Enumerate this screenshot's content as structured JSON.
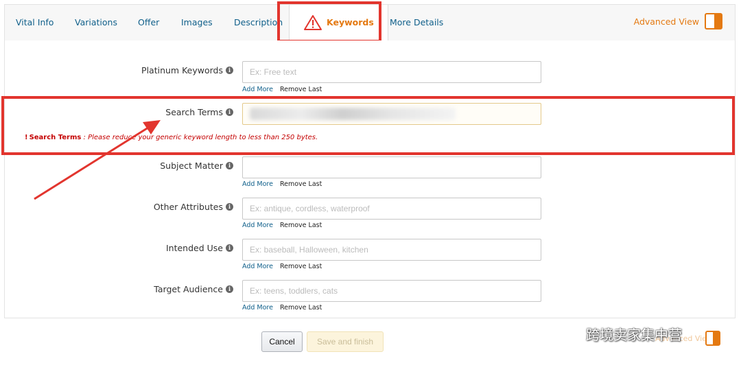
{
  "tabs": [
    {
      "label": "Vital Info"
    },
    {
      "label": "Variations"
    },
    {
      "label": "Offer"
    },
    {
      "label": "Images"
    },
    {
      "label": "Description"
    },
    {
      "label": "Keywords",
      "active": true
    },
    {
      "label": "More Details"
    }
  ],
  "advanced_view": {
    "label": "Advanced View",
    "enabled": true
  },
  "fields": {
    "platinum": {
      "label": "Platinum Keywords",
      "placeholder": "Ex: Free text",
      "add_more": "Add More",
      "remove_last": "Remove Last"
    },
    "search_terms": {
      "label": "Search Terms",
      "value": ""
    },
    "subject_matter": {
      "label": "Subject Matter",
      "placeholder": "",
      "add_more": "Add More",
      "remove_last": "Remove Last"
    },
    "other_attributes": {
      "label": "Other Attributes",
      "placeholder": "Ex: antique, cordless, waterproof",
      "add_more": "Add More",
      "remove_last": "Remove Last"
    },
    "intended_use": {
      "label": "Intended Use",
      "placeholder": "Ex: baseball, Halloween, kitchen",
      "add_more": "Add More",
      "remove_last": "Remove Last"
    },
    "target_audience": {
      "label": "Target Audience",
      "placeholder": "Ex: teens, toddlers, cats",
      "add_more": "Add More",
      "remove_last": "Remove Last"
    }
  },
  "error": {
    "marker": "!",
    "title": "Search Terms",
    "separator": " : ",
    "message": "Please reduce your generic keyword length to less than 250 bytes."
  },
  "info_glyph": "i",
  "buttons": {
    "cancel": "Cancel",
    "save_finish": "Save and finish"
  },
  "watermark": {
    "text": "跨境卖家集中营",
    "ghost_text": "Advanced View"
  },
  "colors": {
    "accent": "#e47911",
    "link": "#0f5f8a",
    "error": "#c40000",
    "highlight": "#e2352e"
  }
}
